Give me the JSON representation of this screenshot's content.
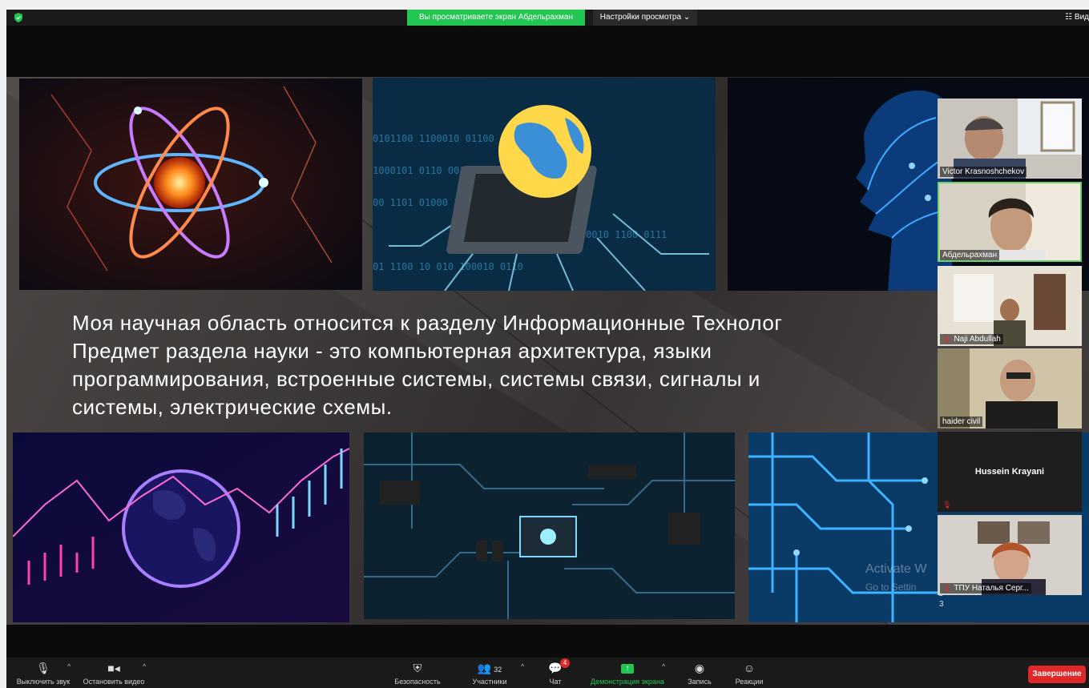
{
  "top_bar": {
    "share_banner": "Вы просматриваете экран Абдельрахман",
    "view_options": "Настройки просмотра ⌄",
    "view_mode": "☷ Вид"
  },
  "slide": {
    "lines": [
      "Моя научная область относится к разделу Информационные Технолог",
      "Предмет раздела науки - это компьютерная архитектура, языки",
      "программирования, встроенные системы, системы связи, сигналы и",
      "системы, электрические схемы."
    ],
    "watermark_line1": "Activate W",
    "watermark_line2": "Go to Settin"
  },
  "participants": [
    {
      "name": "Victor Krasnoshchekov",
      "muted": false
    },
    {
      "name": "Абдельрахман",
      "muted": false
    },
    {
      "name": "Naji Abdullah",
      "muted": true
    },
    {
      "name": "haider civil",
      "muted": false
    },
    {
      "name": "Hussein Krayani",
      "muted": true
    },
    {
      "name": "ТПУ   Наталья Серг...",
      "muted": true
    }
  ],
  "gallery_page": "3",
  "toolbar": {
    "mute": "Выключить звук",
    "stop_video": "Остановить видео",
    "security": "Безопасность",
    "participants": "Участники",
    "participants_count": "32",
    "chat": "Чат",
    "chat_badge": "4",
    "share_screen": "Демонстрация экрана",
    "record": "Запись",
    "reactions": "Реакции",
    "end": "Завершение"
  },
  "colors": {
    "accent_green": "#23c553",
    "end_red": "#e02828",
    "bar_bg": "#1a1a1a"
  },
  "icons": [
    "shield-icon",
    "microphone-icon",
    "camera-icon",
    "security-icon",
    "participants-icon",
    "chat-icon",
    "share-screen-icon",
    "record-icon",
    "reactions-icon"
  ]
}
